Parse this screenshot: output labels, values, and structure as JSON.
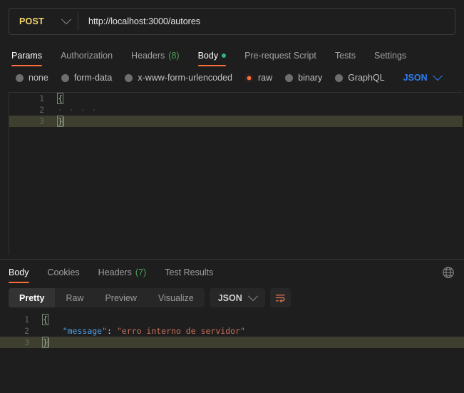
{
  "request": {
    "method": "POST",
    "method_chevron_icon": "chevron-down-icon",
    "url": "http://localhost:3000/autores",
    "tabs": [
      {
        "label": "Params",
        "active": false,
        "count": "",
        "dot": false
      },
      {
        "label": "Authorization",
        "active": false,
        "count": "",
        "dot": false
      },
      {
        "label": "Headers",
        "active": false,
        "count": "(8)",
        "dot": false
      },
      {
        "label": "Body",
        "active": true,
        "count": "",
        "dot": true
      },
      {
        "label": "Pre-request Script",
        "active": false,
        "count": "",
        "dot": false
      },
      {
        "label": "Tests",
        "active": false,
        "count": "",
        "dot": false
      },
      {
        "label": "Settings",
        "active": false,
        "count": "",
        "dot": false
      }
    ],
    "body_types": [
      {
        "label": "none",
        "selected": false
      },
      {
        "label": "form-data",
        "selected": false
      },
      {
        "label": "x-www-form-urlencoded",
        "selected": false
      },
      {
        "label": "raw",
        "selected": true
      },
      {
        "label": "binary",
        "selected": false
      },
      {
        "label": "GraphQL",
        "selected": false
      }
    ],
    "raw_format": "JSON",
    "raw_format_chevron_icon": "chevron-down-icon",
    "editor_lines": [
      {
        "num": "1",
        "open_brace": "{",
        "text": "",
        "active": false,
        "bracket": true,
        "whitespace": ""
      },
      {
        "num": "2",
        "open_brace": "",
        "text": "",
        "active": false,
        "bracket": false,
        "whitespace": "· · · ·"
      },
      {
        "num": "3",
        "open_brace": "}",
        "text": "",
        "active": true,
        "bracket": true,
        "whitespace": ""
      }
    ]
  },
  "response": {
    "tabs": [
      {
        "label": "Body",
        "active": true,
        "count": ""
      },
      {
        "label": "Cookies",
        "active": false,
        "count": ""
      },
      {
        "label": "Headers",
        "active": false,
        "count": "(7)"
      },
      {
        "label": "Test Results",
        "active": false,
        "count": ""
      }
    ],
    "globe_icon": "globe-icon",
    "views": [
      {
        "label": "Pretty",
        "active": true
      },
      {
        "label": "Raw",
        "active": false
      },
      {
        "label": "Preview",
        "active": false
      },
      {
        "label": "Visualize",
        "active": false
      }
    ],
    "format": "JSON",
    "format_chevron_icon": "chevron-down-icon",
    "wrap_lines_icon": "wrap-lines-icon",
    "body_lines": [
      {
        "num": "1",
        "brace": "{",
        "key": "",
        "colon": "",
        "value": "",
        "active": false
      },
      {
        "num": "2",
        "brace": "",
        "key": "\"message\"",
        "colon": ": ",
        "value": "\"erro interno de servidor\"",
        "active": false
      },
      {
        "num": "3",
        "brace": "}",
        "key": "",
        "colon": "",
        "value": "",
        "active": true
      }
    ]
  },
  "colors": {
    "accent_orange": "#ff6c37",
    "method_post": "#f5d76e",
    "json_blue": "#2f7ced",
    "count_green": "#4aa05a",
    "dot_green": "#2eb67d",
    "json_key": "#4ea0e8",
    "json_string": "#c9705c",
    "active_line": "#3f3f30",
    "background": "#1e1e1e"
  }
}
